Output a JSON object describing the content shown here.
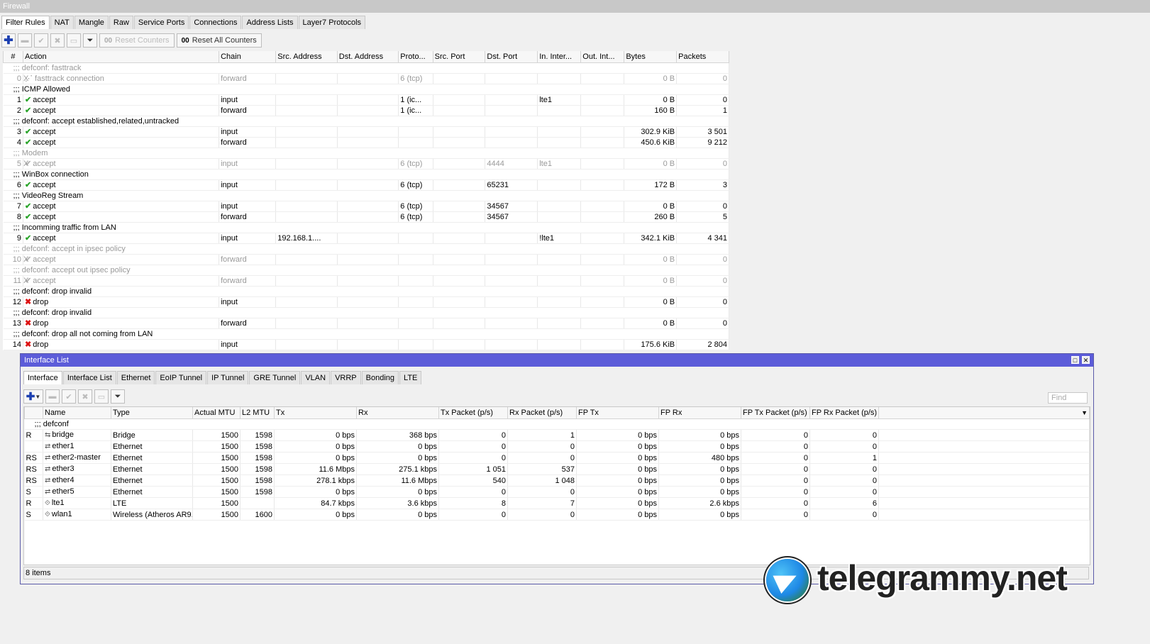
{
  "firewall": {
    "title": "Firewall",
    "tabs": [
      "Filter Rules",
      "NAT",
      "Mangle",
      "Raw",
      "Service Ports",
      "Connections",
      "Address Lists",
      "Layer7 Protocols"
    ],
    "toolbar": {
      "reset_counters": "Reset Counters",
      "reset_all_counters": "Reset All Counters",
      "counter_icon": "00"
    },
    "columns": [
      "#",
      "Action",
      "Chain",
      "Src. Address",
      "Dst. Address",
      "Proto...",
      "Src. Port",
      "Dst. Port",
      "In. Inter...",
      "Out. Int...",
      "Bytes",
      "Packets"
    ],
    "rows": [
      {
        "kind": "comment",
        "disabled": true,
        "text": ";;; defconf: fasttrack"
      },
      {
        "kind": "rule",
        "disabled": true,
        "num": "0",
        "flag": "X",
        "action": "fasttrack connection",
        "action_icon": "fasttrack",
        "chain": "forward",
        "src": "",
        "dst": "",
        "proto": "6 (tcp)",
        "sport": "",
        "dport": "",
        "in": "",
        "out": "",
        "bytes": "0 B",
        "packets": "0"
      },
      {
        "kind": "comment",
        "disabled": false,
        "text": ";;; ICMP Allowed"
      },
      {
        "kind": "rule",
        "disabled": false,
        "num": "1",
        "flag": "",
        "action": "accept",
        "action_icon": "accept",
        "chain": "input",
        "src": "",
        "dst": "",
        "proto": "1 (ic...",
        "sport": "",
        "dport": "",
        "in": "lte1",
        "out": "",
        "bytes": "0 B",
        "packets": "0"
      },
      {
        "kind": "rule",
        "disabled": false,
        "num": "2",
        "flag": "",
        "action": "accept",
        "action_icon": "accept",
        "chain": "forward",
        "src": "",
        "dst": "",
        "proto": "1 (ic...",
        "sport": "",
        "dport": "",
        "in": "",
        "out": "",
        "bytes": "160 B",
        "packets": "1"
      },
      {
        "kind": "comment",
        "disabled": false,
        "text": ";;; defconf: accept established,related,untracked"
      },
      {
        "kind": "rule",
        "disabled": false,
        "num": "3",
        "flag": "",
        "action": "accept",
        "action_icon": "accept",
        "chain": "input",
        "src": "",
        "dst": "",
        "proto": "",
        "sport": "",
        "dport": "",
        "in": "",
        "out": "",
        "bytes": "302.9 KiB",
        "packets": "3 501"
      },
      {
        "kind": "rule",
        "disabled": false,
        "num": "4",
        "flag": "",
        "action": "accept",
        "action_icon": "accept",
        "chain": "forward",
        "src": "",
        "dst": "",
        "proto": "",
        "sport": "",
        "dport": "",
        "in": "",
        "out": "",
        "bytes": "450.6 KiB",
        "packets": "9 212"
      },
      {
        "kind": "comment",
        "disabled": true,
        "text": ";;; Modem"
      },
      {
        "kind": "rule",
        "disabled": true,
        "num": "5",
        "flag": "X",
        "action": "accept",
        "action_icon": "accept",
        "chain": "input",
        "src": "",
        "dst": "",
        "proto": "6 (tcp)",
        "sport": "",
        "dport": "4444",
        "in": "lte1",
        "out": "",
        "bytes": "0 B",
        "packets": "0"
      },
      {
        "kind": "comment",
        "disabled": false,
        "text": ";;; WinBox connection"
      },
      {
        "kind": "rule",
        "disabled": false,
        "num": "6",
        "flag": "",
        "action": "accept",
        "action_icon": "accept",
        "chain": "input",
        "src": "",
        "dst": "",
        "proto": "6 (tcp)",
        "sport": "",
        "dport": "65231",
        "in": "",
        "out": "",
        "bytes": "172 B",
        "packets": "3"
      },
      {
        "kind": "comment",
        "disabled": false,
        "text": ";;; VideoReg Stream"
      },
      {
        "kind": "rule",
        "disabled": false,
        "num": "7",
        "flag": "",
        "action": "accept",
        "action_icon": "accept",
        "chain": "input",
        "src": "",
        "dst": "",
        "proto": "6 (tcp)",
        "sport": "",
        "dport": "34567",
        "in": "",
        "out": "",
        "bytes": "0 B",
        "packets": "0"
      },
      {
        "kind": "rule",
        "disabled": false,
        "num": "8",
        "flag": "",
        "action": "accept",
        "action_icon": "accept",
        "chain": "forward",
        "src": "",
        "dst": "",
        "proto": "6 (tcp)",
        "sport": "",
        "dport": "34567",
        "in": "",
        "out": "",
        "bytes": "260 B",
        "packets": "5"
      },
      {
        "kind": "comment",
        "disabled": false,
        "text": ";;; Incomming traffic from LAN"
      },
      {
        "kind": "rule",
        "disabled": false,
        "num": "9",
        "flag": "",
        "action": "accept",
        "action_icon": "accept",
        "chain": "input",
        "src": "192.168.1....",
        "dst": "",
        "proto": "",
        "sport": "",
        "dport": "",
        "in": "!lte1",
        "out": "",
        "bytes": "342.1 KiB",
        "packets": "4 341"
      },
      {
        "kind": "comment",
        "disabled": true,
        "text": ";;; defconf: accept in ipsec policy"
      },
      {
        "kind": "rule",
        "disabled": true,
        "num": "10",
        "flag": "X",
        "action": "accept",
        "action_icon": "accept",
        "chain": "forward",
        "src": "",
        "dst": "",
        "proto": "",
        "sport": "",
        "dport": "",
        "in": "",
        "out": "",
        "bytes": "0 B",
        "packets": "0"
      },
      {
        "kind": "comment",
        "disabled": true,
        "text": ";;; defconf: accept out ipsec policy"
      },
      {
        "kind": "rule",
        "disabled": true,
        "num": "11",
        "flag": "X",
        "action": "accept",
        "action_icon": "accept",
        "chain": "forward",
        "src": "",
        "dst": "",
        "proto": "",
        "sport": "",
        "dport": "",
        "in": "",
        "out": "",
        "bytes": "0 B",
        "packets": "0"
      },
      {
        "kind": "comment",
        "disabled": false,
        "text": ";;; defconf: drop invalid"
      },
      {
        "kind": "rule",
        "disabled": false,
        "num": "12",
        "flag": "",
        "action": "drop",
        "action_icon": "drop",
        "chain": "input",
        "src": "",
        "dst": "",
        "proto": "",
        "sport": "",
        "dport": "",
        "in": "",
        "out": "",
        "bytes": "0 B",
        "packets": "0"
      },
      {
        "kind": "comment",
        "disabled": false,
        "text": ";;; defconf: drop invalid"
      },
      {
        "kind": "rule",
        "disabled": false,
        "num": "13",
        "flag": "",
        "action": "drop",
        "action_icon": "drop",
        "chain": "forward",
        "src": "",
        "dst": "",
        "proto": "",
        "sport": "",
        "dport": "",
        "in": "",
        "out": "",
        "bytes": "0 B",
        "packets": "0"
      },
      {
        "kind": "comment",
        "disabled": false,
        "text": ";;; defconf: drop all not coming from LAN"
      },
      {
        "kind": "rule",
        "disabled": false,
        "num": "14",
        "flag": "",
        "action": "drop",
        "action_icon": "drop",
        "chain": "input",
        "src": "",
        "dst": "",
        "proto": "",
        "sport": "",
        "dport": "",
        "in": "",
        "out": "",
        "bytes": "175.6 KiB",
        "packets": "2 804"
      }
    ]
  },
  "interface_list": {
    "title": "Interface List",
    "tabs": [
      "Interface",
      "Interface List",
      "Ethernet",
      "EoIP Tunnel",
      "IP Tunnel",
      "GRE Tunnel",
      "VLAN",
      "VRRP",
      "Bonding",
      "LTE"
    ],
    "find_placeholder": "Find",
    "columns": [
      "",
      "Name",
      "Type",
      "Actual MTU",
      "L2 MTU",
      "Tx",
      "Rx",
      "Tx Packet (p/s)",
      "Rx Packet (p/s)",
      "FP Tx",
      "FP Rx",
      "FP Tx Packet (p/s)",
      "FP Rx Packet (p/s)"
    ],
    "group_comment": ";;; defconf",
    "rows": [
      {
        "flags": "R",
        "icon": "bridge",
        "name": "bridge",
        "type": "Bridge",
        "mtu": "1500",
        "l2mtu": "1598",
        "tx": "0 bps",
        "rx": "368 bps",
        "txp": "0",
        "rxp": "1",
        "fptx": "0 bps",
        "fprx": "0 bps",
        "fptxp": "0",
        "fprxp": "0"
      },
      {
        "flags": "",
        "icon": "ethernet",
        "name": "ether1",
        "type": "Ethernet",
        "mtu": "1500",
        "l2mtu": "1598",
        "tx": "0 bps",
        "rx": "0 bps",
        "txp": "0",
        "rxp": "0",
        "fptx": "0 bps",
        "fprx": "0 bps",
        "fptxp": "0",
        "fprxp": "0"
      },
      {
        "flags": "RS",
        "icon": "ethernet",
        "name": "ether2-master",
        "type": "Ethernet",
        "mtu": "1500",
        "l2mtu": "1598",
        "tx": "0 bps",
        "rx": "0 bps",
        "txp": "0",
        "rxp": "0",
        "fptx": "0 bps",
        "fprx": "480 bps",
        "fptxp": "0",
        "fprxp": "1"
      },
      {
        "flags": "RS",
        "icon": "ethernet",
        "name": "ether3",
        "type": "Ethernet",
        "mtu": "1500",
        "l2mtu": "1598",
        "tx": "11.6 Mbps",
        "rx": "275.1 kbps",
        "txp": "1 051",
        "rxp": "537",
        "fptx": "0 bps",
        "fprx": "0 bps",
        "fptxp": "0",
        "fprxp": "0"
      },
      {
        "flags": "RS",
        "icon": "ethernet",
        "name": "ether4",
        "type": "Ethernet",
        "mtu": "1500",
        "l2mtu": "1598",
        "tx": "278.1 kbps",
        "rx": "11.6 Mbps",
        "txp": "540",
        "rxp": "1 048",
        "fptx": "0 bps",
        "fprx": "0 bps",
        "fptxp": "0",
        "fprxp": "0"
      },
      {
        "flags": "S",
        "icon": "ethernet",
        "name": "ether5",
        "type": "Ethernet",
        "mtu": "1500",
        "l2mtu": "1598",
        "tx": "0 bps",
        "rx": "0 bps",
        "txp": "0",
        "rxp": "0",
        "fptx": "0 bps",
        "fprx": "0 bps",
        "fptxp": "0",
        "fprxp": "0"
      },
      {
        "flags": "R",
        "icon": "lte",
        "name": "lte1",
        "type": "LTE",
        "mtu": "1500",
        "l2mtu": "",
        "tx": "84.7 kbps",
        "rx": "3.6 kbps",
        "txp": "8",
        "rxp": "7",
        "fptx": "0 bps",
        "fprx": "2.6 kbps",
        "fptxp": "0",
        "fprxp": "6"
      },
      {
        "flags": "S",
        "icon": "wireless",
        "name": "wlan1",
        "type": "Wireless (Atheros AR9...",
        "mtu": "1500",
        "l2mtu": "1600",
        "tx": "0 bps",
        "rx": "0 bps",
        "txp": "0",
        "rxp": "0",
        "fptx": "0 bps",
        "fprx": "0 bps",
        "fptxp": "0",
        "fprxp": "0"
      }
    ],
    "status": "8 items"
  },
  "watermark": {
    "text": "telegrammy.net",
    "logo": "telegram-plane-logo"
  }
}
